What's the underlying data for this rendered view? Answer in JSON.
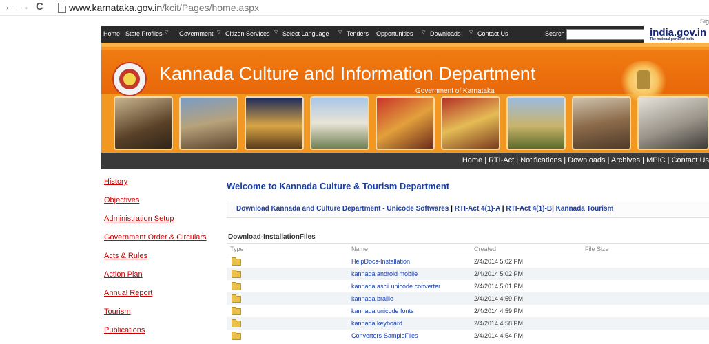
{
  "browser": {
    "back_icon": "left-arrow-icon",
    "forward_icon": "right-arrow-icon",
    "reload_icon": "reload-icon",
    "url_host": "www.karnataka.gov.in",
    "url_path": "/kcit/Pages/home.aspx",
    "sign_in_partial": "Sig"
  },
  "topnav": {
    "items": [
      "Home",
      "State Profiles",
      "Government",
      "Citizen Services",
      "Select Language",
      "Tenders",
      "Opportunities",
      "Downloads",
      "Contact Us"
    ],
    "search_label": "Search",
    "search_value": "",
    "search_go": "→",
    "portal_title": "india.gov.in",
    "portal_subtitle": "The national portal of India"
  },
  "banner": {
    "title": "Kannada Culture and Information Department",
    "subtitle": "Government of Karnataka"
  },
  "darkband": {
    "links": [
      "Home",
      "RTI-Act",
      "Notifications",
      "Downloads",
      "Archives",
      "MPIC",
      "Contact Us"
    ]
  },
  "sidebar": {
    "items": [
      "History",
      "Objectives",
      "Administration Setup",
      "Government Order & Circulars",
      "Acts & Rules",
      "Action Plan",
      "Annual Report",
      "Tourism",
      "Publications"
    ]
  },
  "main": {
    "welcome": "Welcome to Kannada Culture & Tourism Department",
    "quick_links": [
      "Download Kannada and Culture Department - Unicode Softwares",
      "RTI-Act 4(1)-A",
      "RTI-Act 4(1)-B",
      "Kannada Tourism"
    ],
    "section_title": "Download-InstallationFiles",
    "table": {
      "headers": [
        "Type",
        "Name",
        "Created",
        "File Size"
      ],
      "rows": [
        {
          "name": "HelpDocs-Installation",
          "created": "2/4/2014 5:02 PM"
        },
        {
          "name": "kannada android mobile",
          "created": "2/4/2014 5:02 PM"
        },
        {
          "name": "kannada ascii unicode converter",
          "created": "2/4/2014 5:01 PM"
        },
        {
          "name": "kannada braille",
          "created": "2/4/2014 4:59 PM"
        },
        {
          "name": "kannada unicode fonts",
          "created": "2/4/2014 4:59 PM"
        },
        {
          "name": "kannada keyboard",
          "created": "2/4/2014 4:58 PM"
        },
        {
          "name": "Converters-SampleFiles",
          "created": "2/4/2014 4:54 PM"
        }
      ]
    }
  }
}
